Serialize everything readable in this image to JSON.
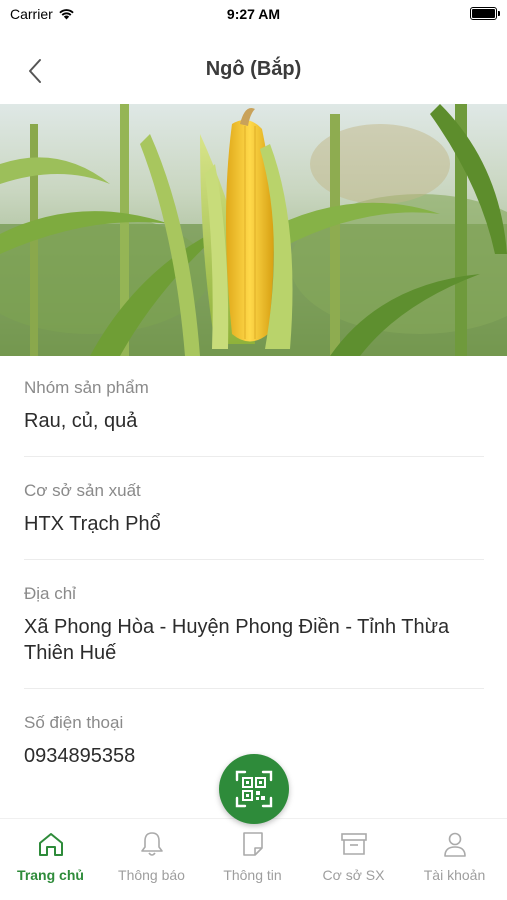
{
  "status_bar": {
    "carrier": "Carrier",
    "time": "9:27 AM"
  },
  "nav": {
    "title": "Ngô (Bắp)"
  },
  "hero": {
    "image_subject": "corn-field-photo"
  },
  "fields": [
    {
      "label": "Nhóm sản phẩm",
      "value": "Rau, củ, quả"
    },
    {
      "label": "Cơ sở sản xuất",
      "value": "HTX Trạch Phổ"
    },
    {
      "label": "Địa chỉ",
      "value": "Xã Phong Hòa -  Huyện Phong Điền - Tỉnh Thừa Thiên Huế"
    },
    {
      "label": "Số điện thoại",
      "value": "0934895358"
    }
  ],
  "tabs": [
    {
      "label": "Trang chủ",
      "icon": "home-icon",
      "active": true
    },
    {
      "label": "Thông báo",
      "icon": "bell-icon",
      "active": false
    },
    {
      "label": "Thông tin",
      "icon": "note-icon",
      "active": false
    },
    {
      "label": "Cơ sở SX",
      "icon": "archive-icon",
      "active": false
    },
    {
      "label": "Tài khoản",
      "icon": "user-icon",
      "active": false
    }
  ],
  "colors": {
    "accent": "#2e8b3a",
    "inactive": "#9e9e9e",
    "label": "#8a8a8a"
  }
}
